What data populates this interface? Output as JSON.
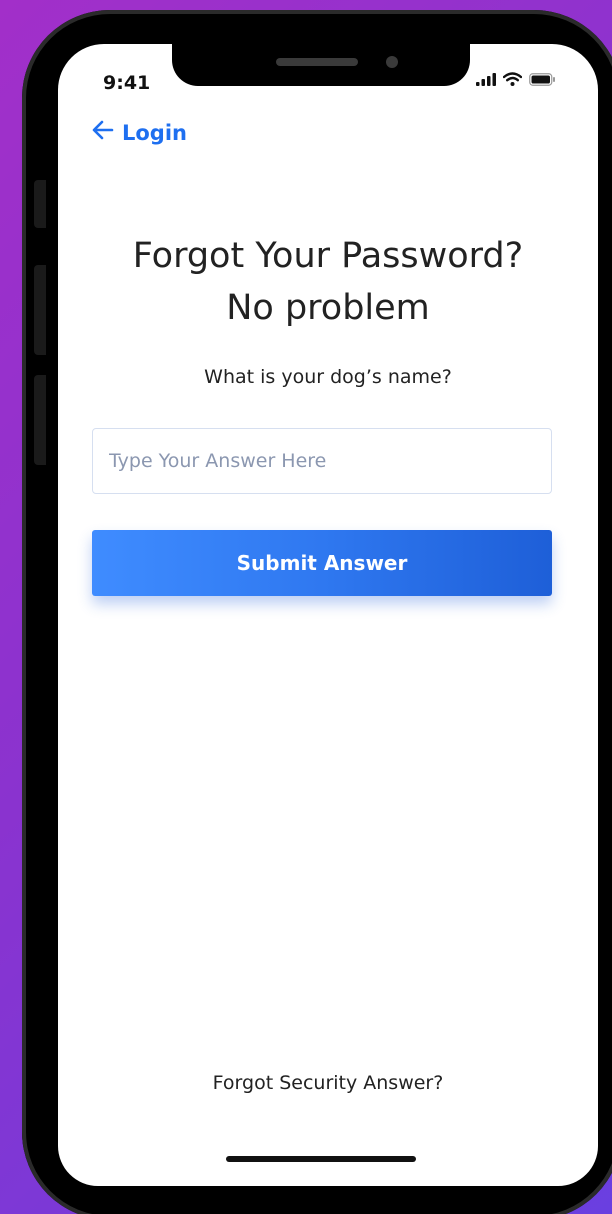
{
  "status_bar": {
    "time": "9:41"
  },
  "nav": {
    "back_label": "Login"
  },
  "page": {
    "title_line1": "Forgot Your Password?",
    "title_line2": "No problem",
    "question": "What is your dog’s name?",
    "answer_placeholder": "Type Your Answer Here",
    "answer_value": "",
    "submit_label": "Submit Answer",
    "forgot_link": "Forgot Security Answer?"
  },
  "colors": {
    "accent": "#1e6ff0",
    "background_gradient_start": "#a22fc9",
    "background_gradient_end": "#6a3fe0"
  },
  "icons": {
    "back": "arrow-left-icon",
    "signal": "cellular-signal-icon",
    "wifi": "wifi-icon",
    "battery": "battery-icon"
  }
}
